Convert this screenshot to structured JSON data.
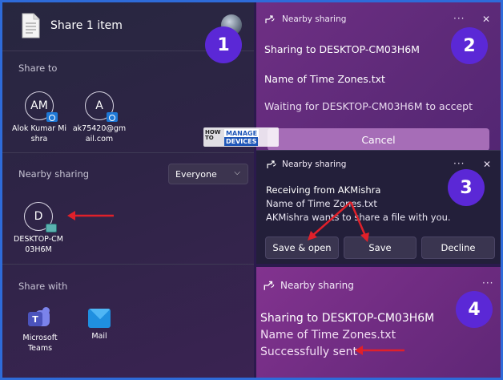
{
  "share": {
    "title": "Share 1 item",
    "share_to_label": "Share to",
    "contacts": [
      {
        "initials": "AM",
        "name": "Alok Kumar Mishra"
      },
      {
        "initials": "A",
        "name": "ak75420@gmail.com"
      }
    ],
    "nearby_label": "Nearby sharing",
    "nearby_dropdown_value": "Everyone",
    "device": {
      "initial": "D",
      "name": "DESKTOP-CM03H6M"
    },
    "share_with_label": "Share with",
    "apps": [
      {
        "name": "Microsoft Teams",
        "icon": "teams-icon"
      },
      {
        "name": "Mail",
        "icon": "mail-icon"
      }
    ]
  },
  "badges": [
    "1",
    "2",
    "3",
    "4"
  ],
  "panel2": {
    "header": "Nearby sharing",
    "line1": "Sharing to DESKTOP-CM03H6M",
    "line2": "Name of Time Zones.txt",
    "line3": "Waiting for DESKTOP-CM03H6M to accept",
    "cancel": "Cancel"
  },
  "panel3": {
    "header": "Nearby sharing",
    "line1": "Receiving from AKMishra",
    "line2": "Name of Time Zones.txt",
    "line3": "AKMishra wants to share a file with you.",
    "btn_save_open": "Save & open",
    "btn_save": "Save",
    "btn_decline": "Decline"
  },
  "panel4": {
    "header": "Nearby sharing",
    "line1": "Sharing to DESKTOP-CM03H6M",
    "line2": "Name of Time Zones.txt",
    "line3": "Successfully sent"
  },
  "watermark": {
    "how": "HOW TO",
    "line1": "MANAGE",
    "line2": "DEVICES"
  },
  "colors": {
    "accent_badge": "#5b28d6",
    "arrow": "#e0202a",
    "frame": "#2e6bd9"
  }
}
